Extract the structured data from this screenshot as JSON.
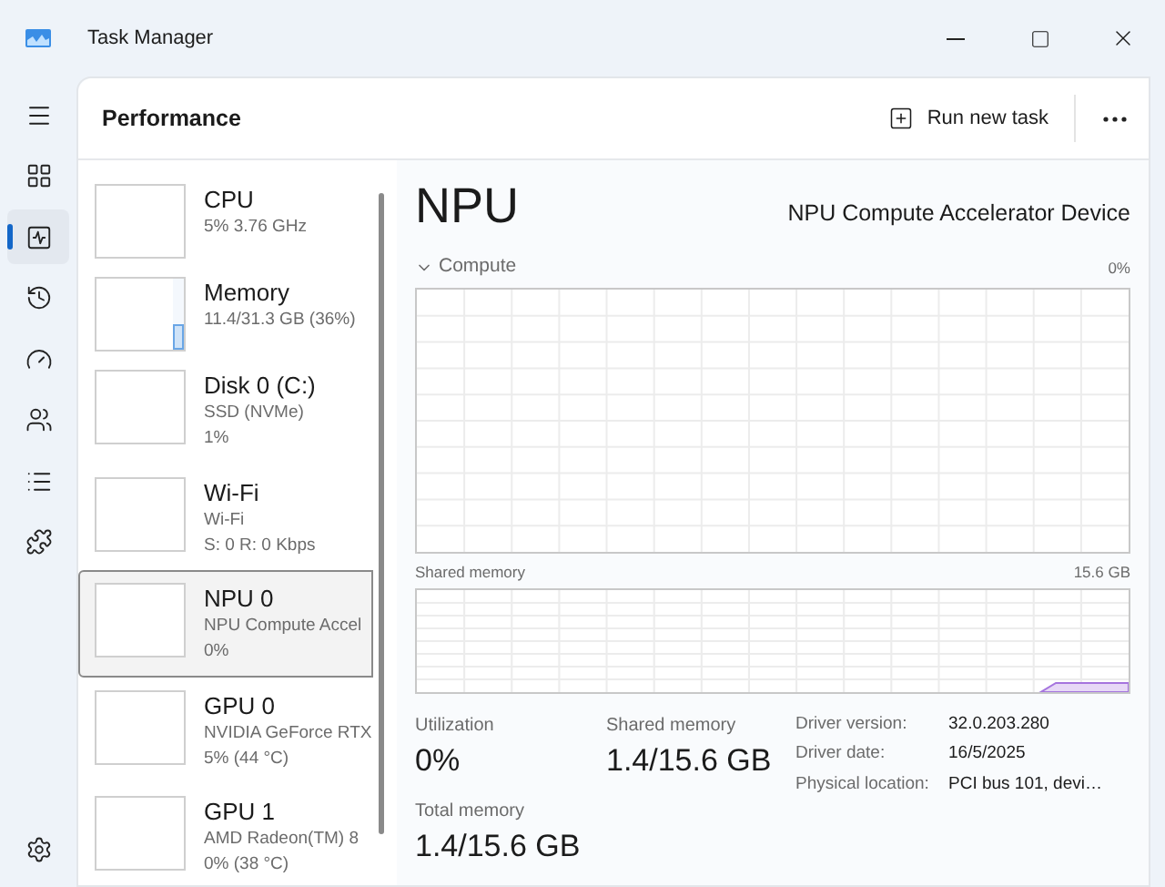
{
  "window": {
    "title": "Task Manager"
  },
  "nav": [
    {
      "kind": "menu",
      "selected": false
    },
    {
      "kind": "processes",
      "selected": false
    },
    {
      "kind": "performance",
      "selected": true
    },
    {
      "kind": "history",
      "selected": false
    },
    {
      "kind": "startup",
      "selected": false
    },
    {
      "kind": "users",
      "selected": false
    },
    {
      "kind": "details",
      "selected": false
    },
    {
      "kind": "services",
      "selected": false
    }
  ],
  "settings_nav": {
    "kind": "settings",
    "selected": false
  },
  "page": {
    "title": "Performance",
    "run_new_task": "Run new task"
  },
  "devices": [
    {
      "name": "CPU",
      "lines": [
        "5%  3.76 GHz"
      ],
      "selected": false
    },
    {
      "name": "Memory",
      "lines": [
        "11.4/31.3 GB (36%)"
      ],
      "selected": false,
      "level": 0.36
    },
    {
      "name": "Disk 0 (C:)",
      "lines": [
        "SSD (NVMe)",
        "1%"
      ],
      "selected": false
    },
    {
      "name": "Wi-Fi",
      "lines": [
        "Wi-Fi",
        "S: 0  R: 0 Kbps"
      ],
      "selected": false
    },
    {
      "name": "NPU 0",
      "lines": [
        "NPU Compute Accel",
        "0%"
      ],
      "selected": true
    },
    {
      "name": "GPU 0",
      "lines": [
        "NVIDIA GeForce RTX",
        "5%  (44 °C)"
      ],
      "selected": false
    },
    {
      "name": "GPU 1",
      "lines": [
        "AMD Radeon(TM) 8",
        "0%  (38 °C)"
      ],
      "selected": false
    }
  ],
  "detail": {
    "title": "NPU",
    "device": "NPU Compute Accelerator Device",
    "compute_graph": {
      "label": "Compute",
      "max": "0%"
    },
    "shared_graph": {
      "label": "Shared memory",
      "max": "15.6 GB"
    },
    "stats": [
      {
        "label": "Utilization",
        "value": "0%"
      },
      {
        "label": "Shared memory",
        "value": "1.4/15.6 GB"
      },
      {
        "label": "Total memory",
        "value": "1.4/15.6 GB"
      }
    ],
    "properties": [
      {
        "label": "Driver version:",
        "value": "32.0.203.280"
      },
      {
        "label": "Driver date:",
        "value": "16/5/2025"
      },
      {
        "label": "Physical location:",
        "value": "PCI bus 101, devi…"
      }
    ]
  }
}
